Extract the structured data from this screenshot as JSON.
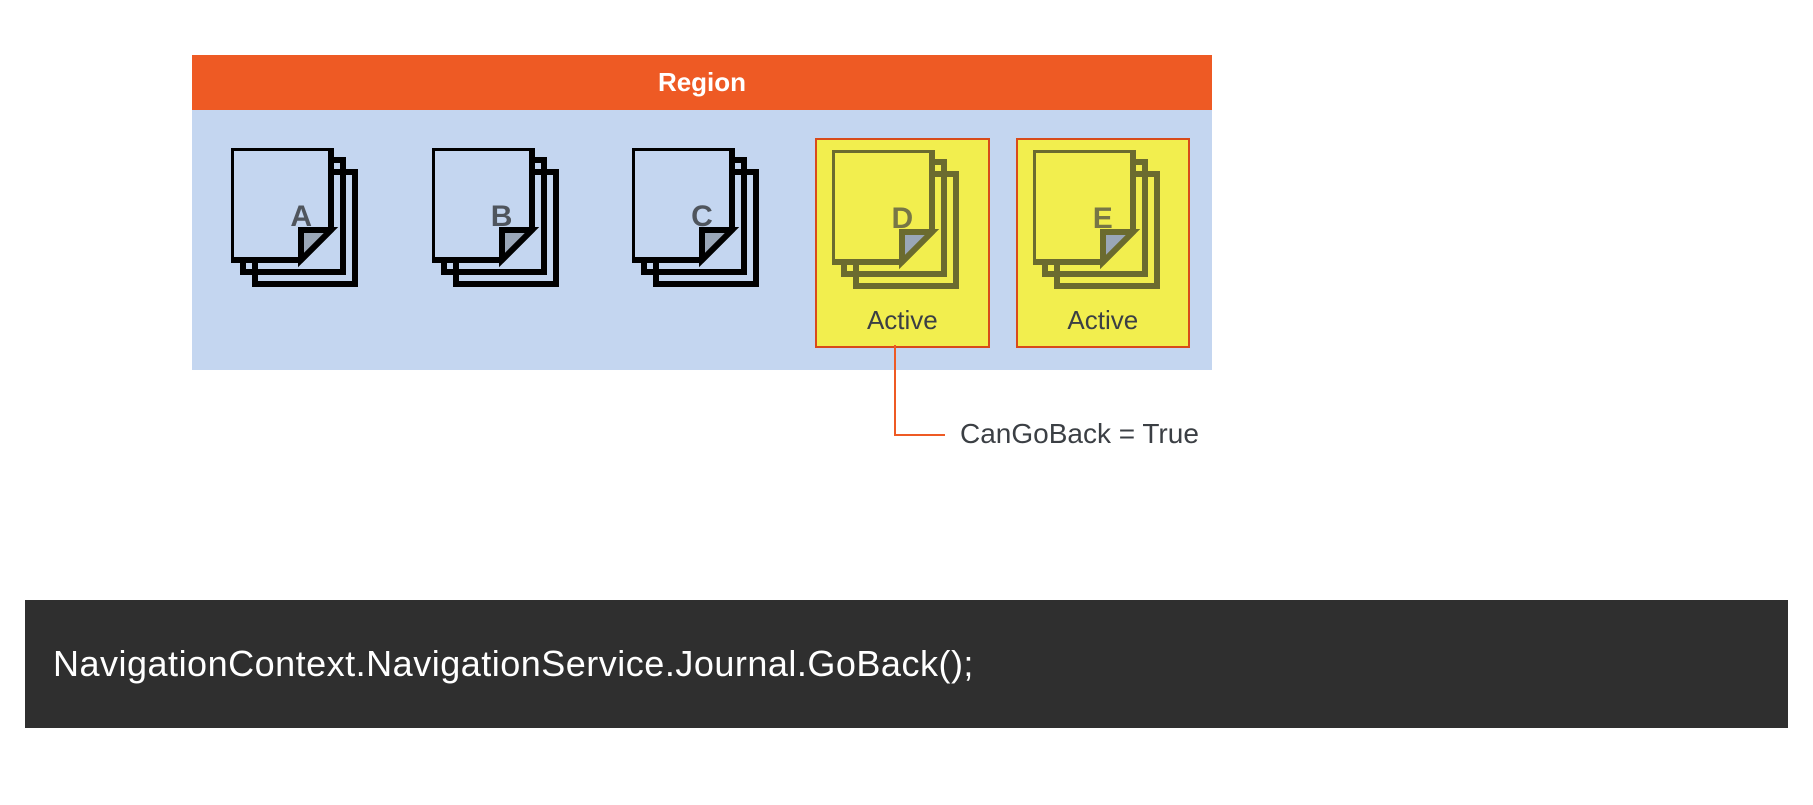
{
  "region": {
    "title": "Region",
    "views": [
      {
        "label": "A",
        "active": false
      },
      {
        "label": "B",
        "active": false
      },
      {
        "label": "C",
        "active": false
      },
      {
        "label": "D",
        "active": true,
        "active_label": "Active"
      },
      {
        "label": "E",
        "active": true,
        "active_label": "Active"
      }
    ]
  },
  "callout": {
    "text": "CanGoBack = True"
  },
  "code": "NavigationContext.NavigationService.Journal.GoBack();",
  "colors": {
    "header": "#ee5a24",
    "region_body": "#c4d6f0",
    "active_fill": "#f2ee4e",
    "active_border": "#d84b1a",
    "code_bg": "#2f2f2f"
  }
}
